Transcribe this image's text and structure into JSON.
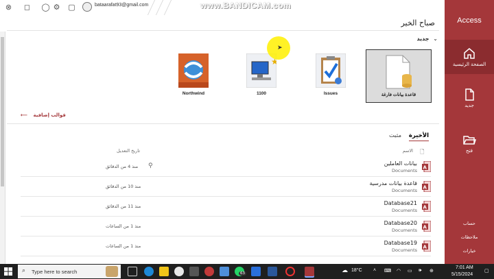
{
  "titlebar": {
    "account_email": "bataarafat93@gmail.com"
  },
  "watermark": "www.BANDICAM.com",
  "sidebar": {
    "app_name": "Access",
    "items": [
      {
        "label": "الصفحة الرئيسية",
        "icon": "home-icon"
      },
      {
        "label": "جديد",
        "icon": "new-file-icon"
      },
      {
        "label": "فتح",
        "icon": "folder-open-icon"
      }
    ],
    "bottom": [
      "حساب",
      "ملاحظات",
      "خيارات"
    ]
  },
  "main": {
    "greeting": "صباح الخير",
    "new_heading": "جديد",
    "templates": [
      {
        "caption": "قاعدة بيانات فارغة"
      },
      {
        "caption": "Issues"
      },
      {
        "caption": "1100"
      },
      {
        "caption": "Northwind"
      }
    ],
    "more_templates": "قوالب إضافية",
    "tabs": [
      "الأخيرة",
      "مثبت"
    ],
    "col_name": "الاسم",
    "col_modified": "تاريخ التعديل",
    "files": [
      {
        "name": "بيانات العاملين",
        "location": "Documents",
        "modified": "منذ 4 من الدقائق"
      },
      {
        "name": "قاعدة بيانات مدرسية",
        "location": "Documents",
        "modified": "منذ 10 من الدقائق"
      },
      {
        "name": "Database21",
        "location": "Documents",
        "modified": "منذ 11 من الدقائق"
      },
      {
        "name": "Database20",
        "location": "Documents",
        "modified": "منذ 1 من الساعات"
      },
      {
        "name": "Database19",
        "location": "Documents",
        "modified": "منذ 1 من الساعات"
      }
    ]
  },
  "taskbar": {
    "search_placeholder": "Type here to search",
    "badge": "63",
    "weather": "18°C",
    "time": "7:01 AM",
    "date": "5/15/2024",
    "colors": {
      "accent": "#a4373a",
      "taskbar": "#1f1f1f"
    }
  }
}
